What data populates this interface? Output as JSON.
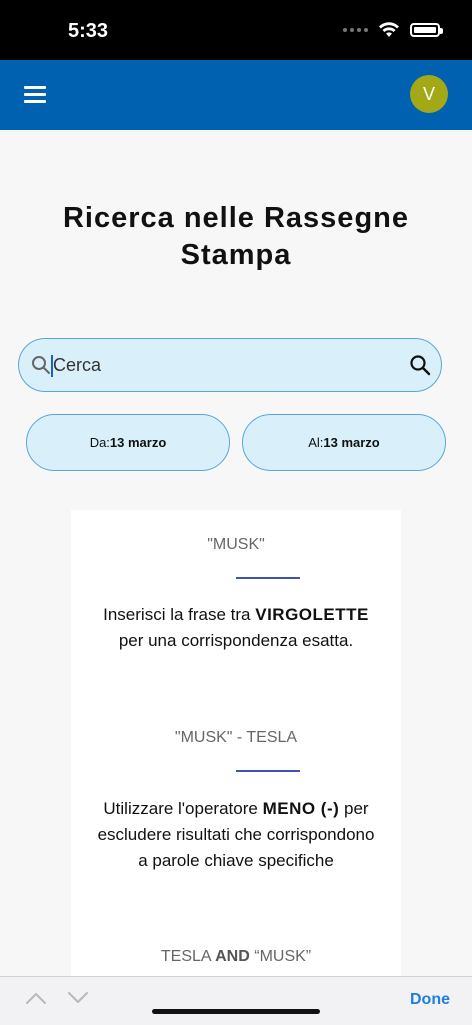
{
  "status_bar": {
    "time": "5:33"
  },
  "app_bar": {
    "avatar_initial": "V"
  },
  "page": {
    "title": "Ricerca nelle Rassegne Stampa"
  },
  "search": {
    "placeholder": "Cerca",
    "value": ""
  },
  "date_filter": {
    "from_label": "Da:",
    "from_value": "13 marzo",
    "to_label": "Al:",
    "to_value": "13 marzo"
  },
  "help": {
    "example1": {
      "query": "\"MUSK\"",
      "desc_pre": "Inserisci la frase tra ",
      "desc_bold": "VIRGOLETTE",
      "desc_post": " per una corrispondenza esatta."
    },
    "example2": {
      "query": "\"MUSK\" - TESLA",
      "desc_pre": "Utilizzare l'operatore ",
      "desc_bold": "MENO (-)",
      "desc_post": " per escludere risultati che corrispondono a parole chiave specifiche"
    },
    "example3": {
      "query_pre": "TESLA ",
      "query_bold": "AND",
      "query_post": " “MUSK”"
    }
  },
  "keyboard_toolbar": {
    "done_label": "Done"
  },
  "colors": {
    "app_bar": "#0061b0",
    "avatar": "#a3a816",
    "search_bg": "#d9f0fa",
    "divider": "#3f51b5",
    "done": "#1e7fe0"
  }
}
